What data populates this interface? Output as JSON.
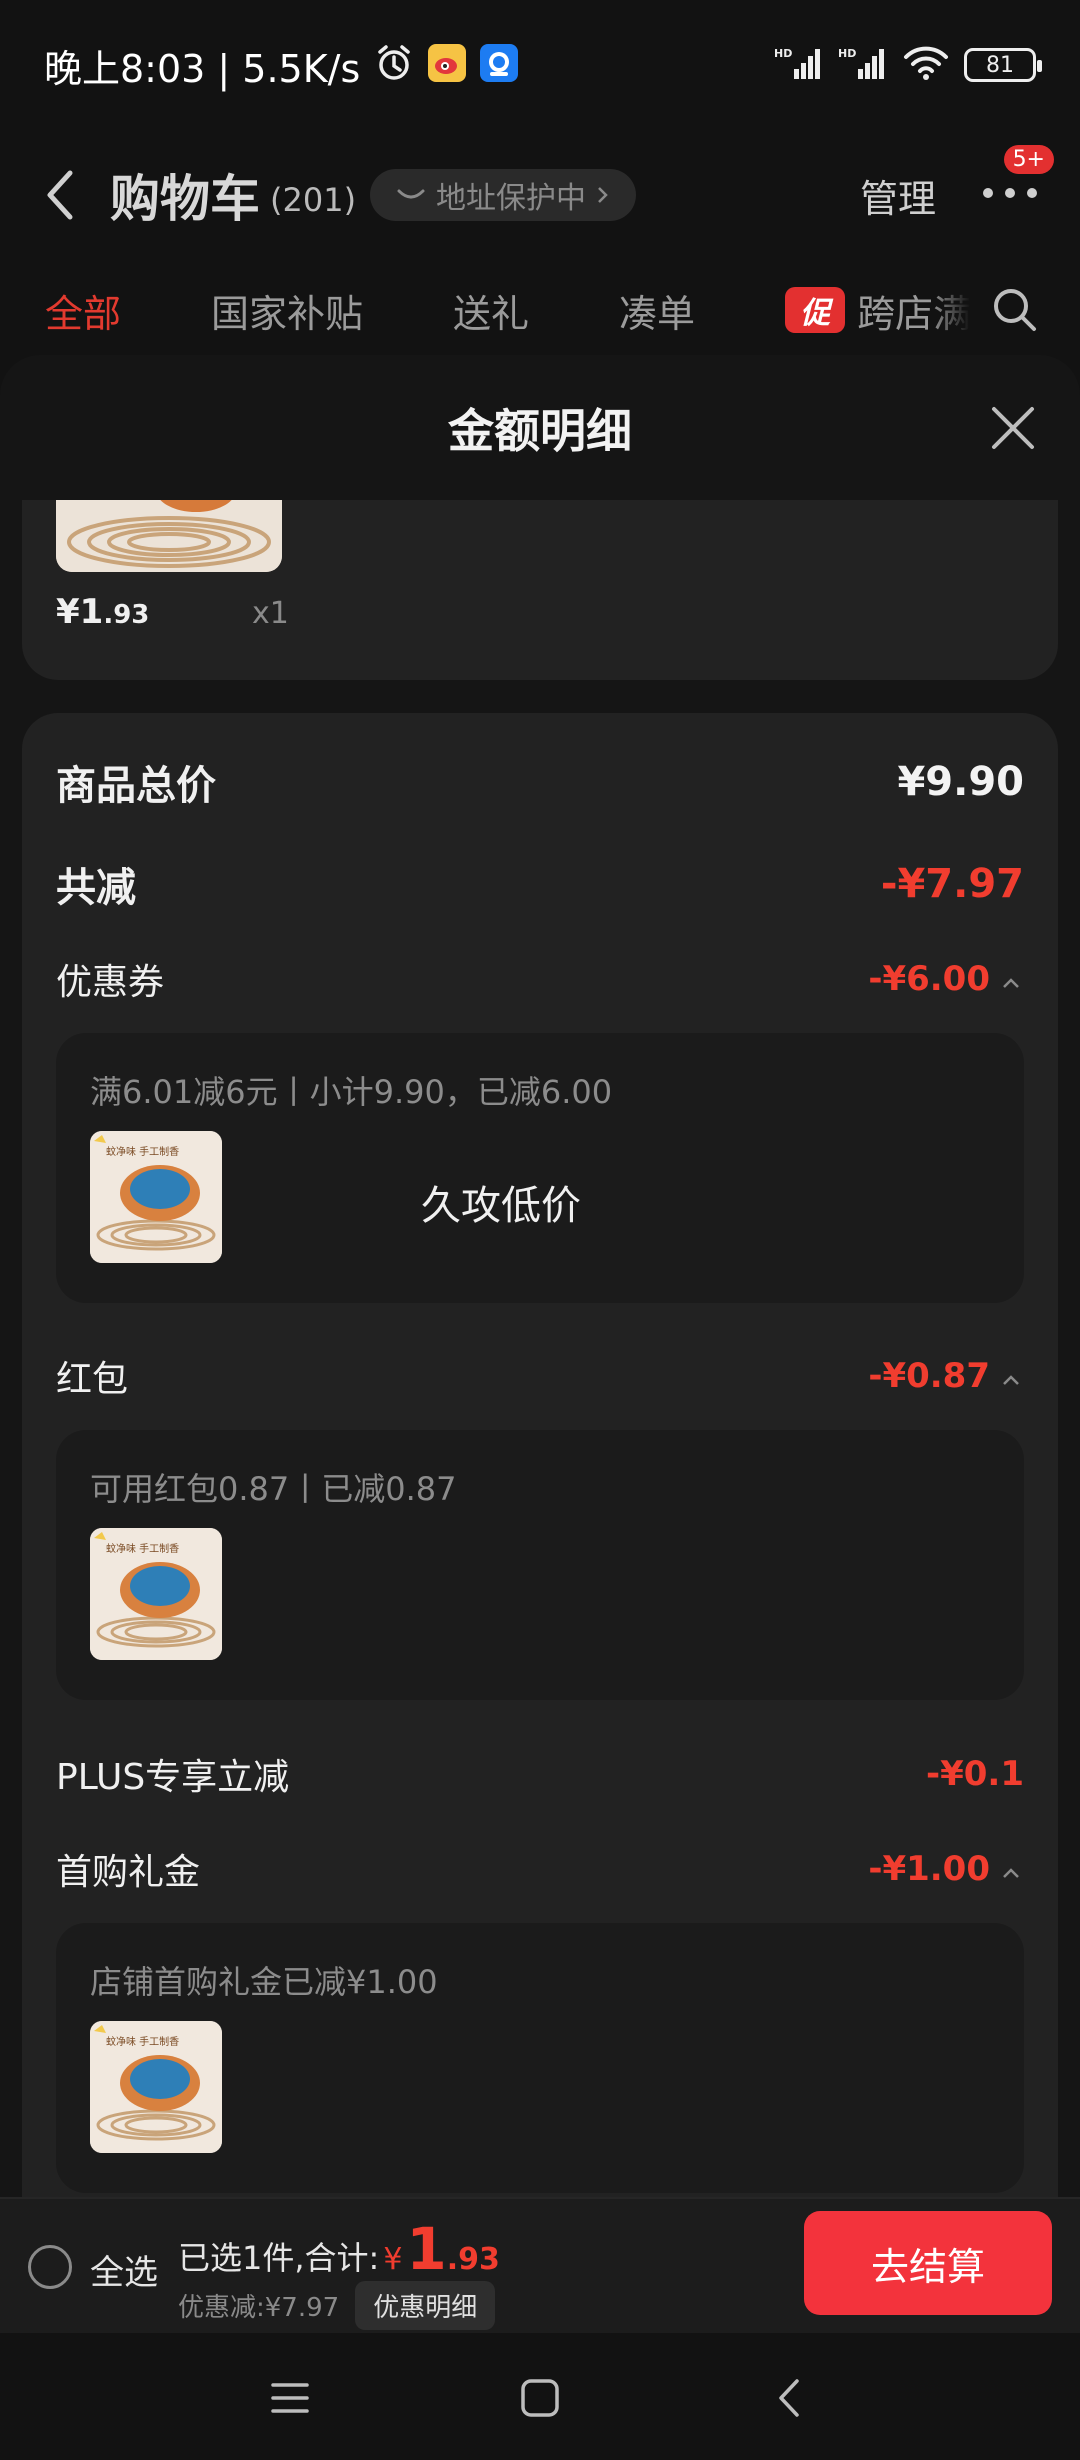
{
  "status_bar": {
    "time": "晚上8:03 | 5.5K/s",
    "battery": "81",
    "icons": [
      "alarm-icon",
      "weibo-icon",
      "app-notification-icon",
      "signal-hd-icon",
      "signal-hd-icon",
      "wifi-icon",
      "battery-icon"
    ]
  },
  "header": {
    "title": "购物车",
    "count": "(201)",
    "address": "地址保护中",
    "manage": "管理",
    "badge": "5+"
  },
  "tabs": [
    {
      "label": "全部"
    },
    {
      "label": "国家补贴"
    },
    {
      "label": "送礼"
    },
    {
      "label": "凑单"
    },
    {
      "label": "跨店满",
      "badge": "促"
    }
  ],
  "sheet": {
    "title": "金额明细",
    "previous_item": {
      "price_int": "¥1",
      "price_dec": ".93",
      "qty": "x1"
    },
    "summary": {
      "total_label": "商品总价",
      "total_value": "¥9.90",
      "reduce_label": "共减",
      "reduce_value": "-¥7.97"
    },
    "coupon": {
      "label": "优惠券",
      "value": "-¥6.00",
      "detail": "满6.01减6元丨小计9.90，已减6.00",
      "note": "久攻低价"
    },
    "red_packet": {
      "label": "红包",
      "value": "-¥0.87",
      "detail": "可用红包0.87丨已减0.87"
    },
    "plus": {
      "label": "PLUS专享立减",
      "value": "-¥0.1"
    },
    "first_buy": {
      "label": "首购礼金",
      "value": "-¥1.00",
      "detail": "店铺首购礼金已减¥1.00"
    },
    "product_tag": "蚊净味 手工制香"
  },
  "checkout": {
    "select_all": "全选",
    "summary_prefix": "已选1件,合计:",
    "currency": "¥",
    "amount_int": "1",
    "amount_dec": ".93",
    "discount": "优惠减:¥7.97",
    "discount_detail": "优惠明细",
    "pay_button": "去结算"
  },
  "colors": {
    "accent_red": "#f13d2f",
    "button_red": "#f3333c",
    "card_bg": "#222222"
  }
}
